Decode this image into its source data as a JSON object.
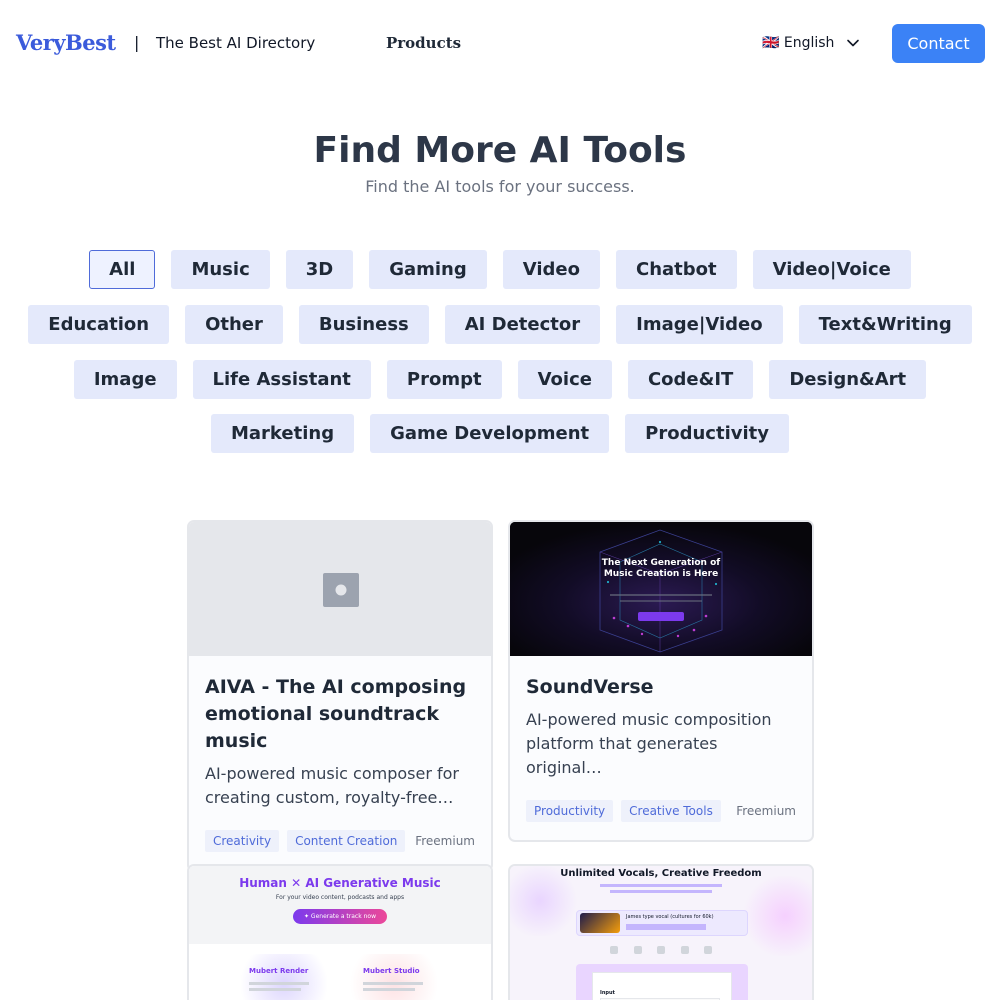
{
  "header": {
    "logo": "VeryBest",
    "separator": "|",
    "tagline": "The Best AI Directory",
    "nav_products": "Products",
    "language": "🇬🇧 English",
    "contact": "Contact"
  },
  "hero": {
    "title": "Find More AI Tools",
    "subtitle": "Find the AI tools for your success."
  },
  "categories": {
    "row1": [
      "All",
      "Music",
      "3D",
      "Gaming",
      "Video",
      "Chatbot",
      "Video|Voice"
    ],
    "row2": [
      "Education",
      "Other",
      "Business",
      "AI Detector",
      "Image|Video",
      "Text&Writing"
    ],
    "row3": [
      "Image",
      "Life Assistant",
      "Prompt",
      "Voice",
      "Code&IT",
      "Design&Art"
    ],
    "row4": [
      "Marketing",
      "Game Development",
      "Productivity"
    ],
    "selected": "All"
  },
  "cards": [
    {
      "title": "AIVA - The AI composing emotional soundtrack music",
      "description": "AI-powered music composer for creating custom, royalty-free…",
      "tags": [
        "Creativity",
        "Content Creation"
      ],
      "pricing": "Freemium"
    },
    {
      "title": "SoundVerse",
      "description": "AI-powered music composition platform that generates original…",
      "tags": [
        "Productivity",
        "Creative Tools"
      ],
      "pricing": "Freemium",
      "thumb_heading": "The Next Generation of Music Creation is Here"
    },
    {
      "thumb_heading": "Human ✕ AI Generative Music",
      "thumb_sub": "For your video content, podcasts and apps",
      "thumb_button": "✦ Generate a track now",
      "thumb_col1": "Mubert Render",
      "thumb_col2": "Mubert Studio"
    },
    {
      "thumb_heading": "Unlimited Vocals, Creative Freedom",
      "thumb_item": "James type vocal (cultures for 60k)",
      "thumb_label": "Input"
    }
  ],
  "colors": {
    "brand": "#3b5bdb",
    "contact_button": "#3b82f6",
    "pill_bg": "#e4e9fb",
    "pill_active_border": "#4f6bd9"
  }
}
